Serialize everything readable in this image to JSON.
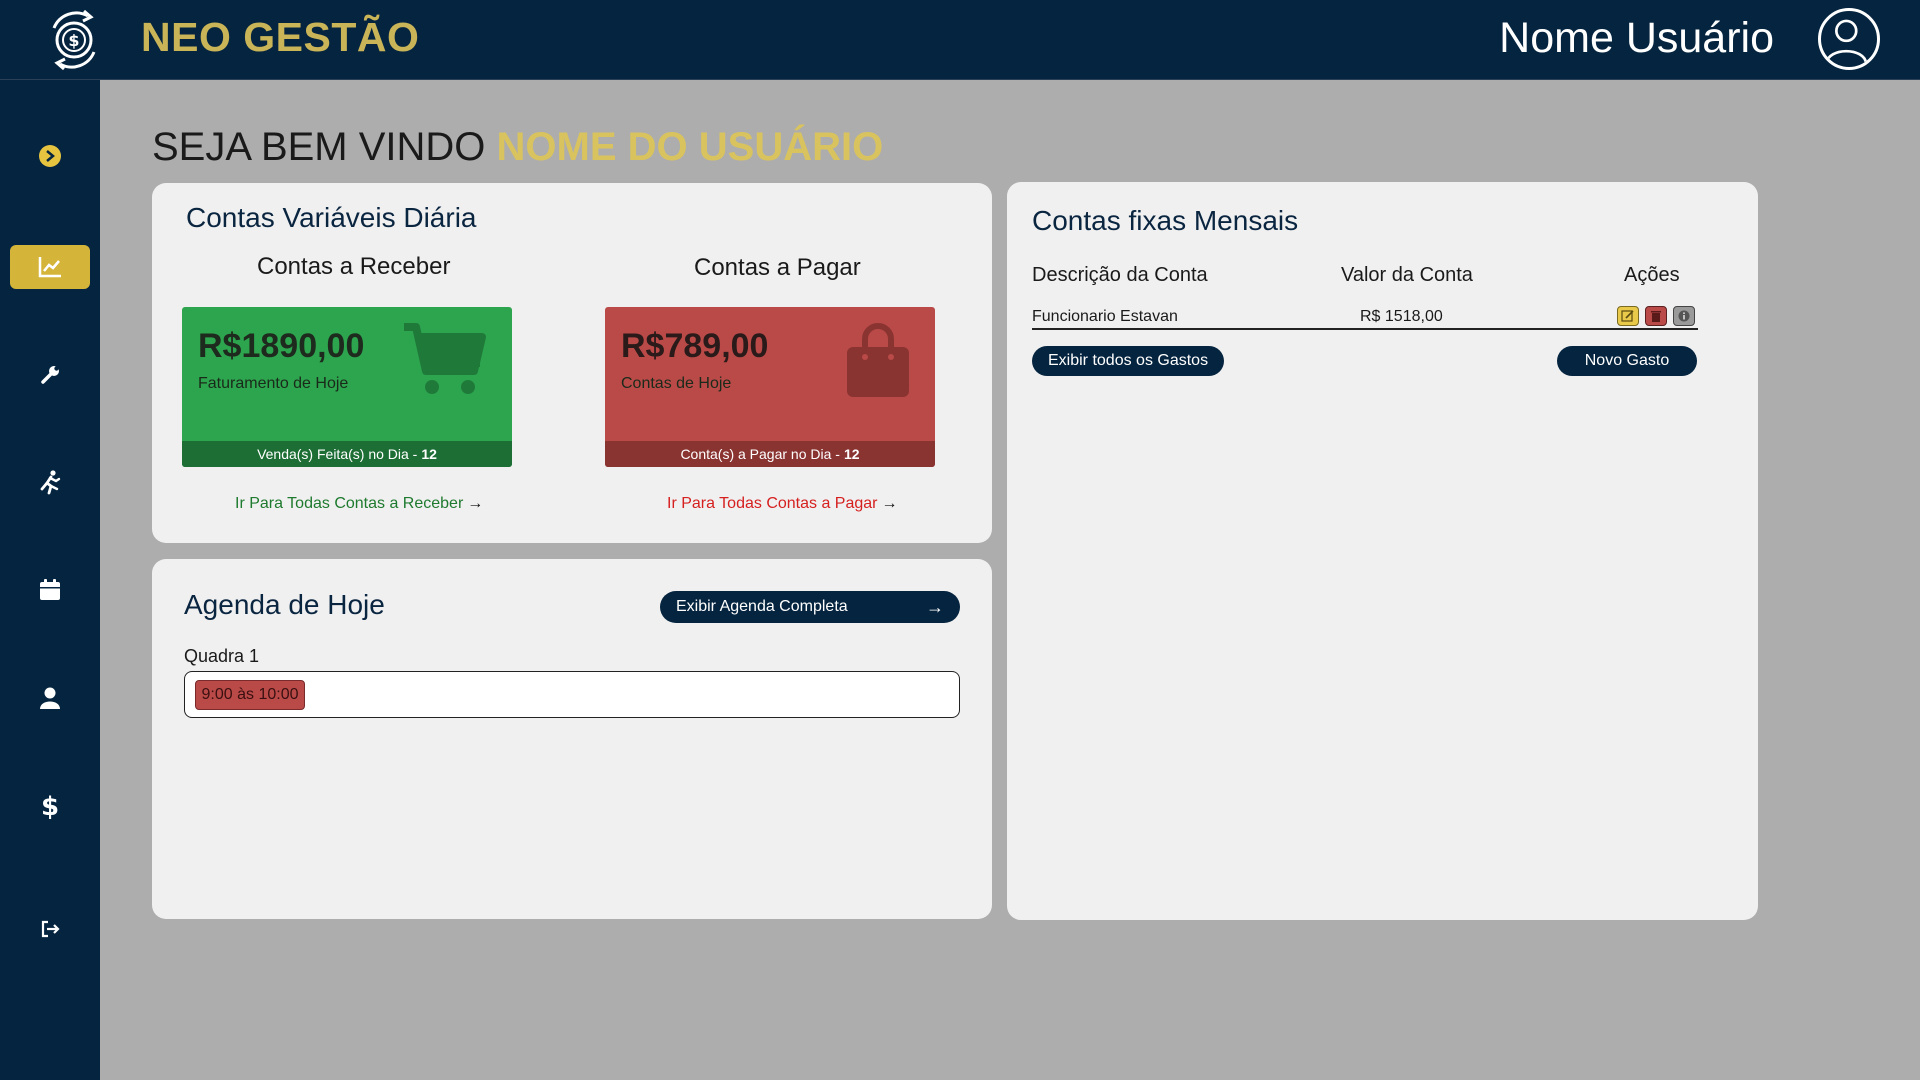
{
  "header": {
    "app_title": "NEO GESTÃO",
    "user_name": "Nome Usuário",
    "logo_icon": "dollar-cycle-icon",
    "avatar_icon": "user-avatar-icon"
  },
  "sidebar": {
    "items": [
      {
        "name": "expand",
        "icon": "chevron-right-circle-icon"
      },
      {
        "name": "dashboard",
        "icon": "line-chart-icon",
        "active": true
      },
      {
        "name": "tools",
        "icon": "wrench-icon"
      },
      {
        "name": "sports",
        "icon": "running-icon"
      },
      {
        "name": "calendar",
        "icon": "calendar-icon"
      },
      {
        "name": "users",
        "icon": "user-icon"
      },
      {
        "name": "finance",
        "icon": "dollar-icon"
      },
      {
        "name": "logout",
        "icon": "logout-icon"
      }
    ],
    "accent": "#d4b53a"
  },
  "welcome": {
    "prefix": "SEJA BEM VINDO",
    "name": "NOME DO USUÁRIO"
  },
  "daily": {
    "title": "Contas Variáveis Diária",
    "receivable": {
      "heading": "Contas a Receber",
      "amount": "R$1890,00",
      "caption": "Faturamento de Hoje",
      "footer_text": "Venda(s) Feita(s) no Dia - ",
      "footer_count": "12",
      "link": "Ir Para Todas Contas a Receber",
      "color": "#2da44e"
    },
    "payable": {
      "heading": "Contas a Pagar",
      "amount": "R$789,00",
      "caption": "Contas de Hoje",
      "footer_text": "Conta(s) a Pagar no Dia - ",
      "footer_count": "12",
      "link": "Ir Para Todas Contas a Pagar",
      "color": "#b94a48"
    }
  },
  "agenda": {
    "title": "Agenda de Hoje",
    "button": "Exibir Agenda Completa",
    "court": "Quadra 1",
    "slot": "9:00 às 10:00"
  },
  "fixed": {
    "title": "Contas fixas Mensais",
    "columns": [
      "Descrição da Conta",
      "Valor da Conta",
      "Ações"
    ],
    "rows": [
      {
        "description": "Funcionario Estavan",
        "value": "R$ 1518,00"
      }
    ],
    "show_all_button": "Exibir todos os Gastos",
    "new_button": "Novo Gasto"
  }
}
